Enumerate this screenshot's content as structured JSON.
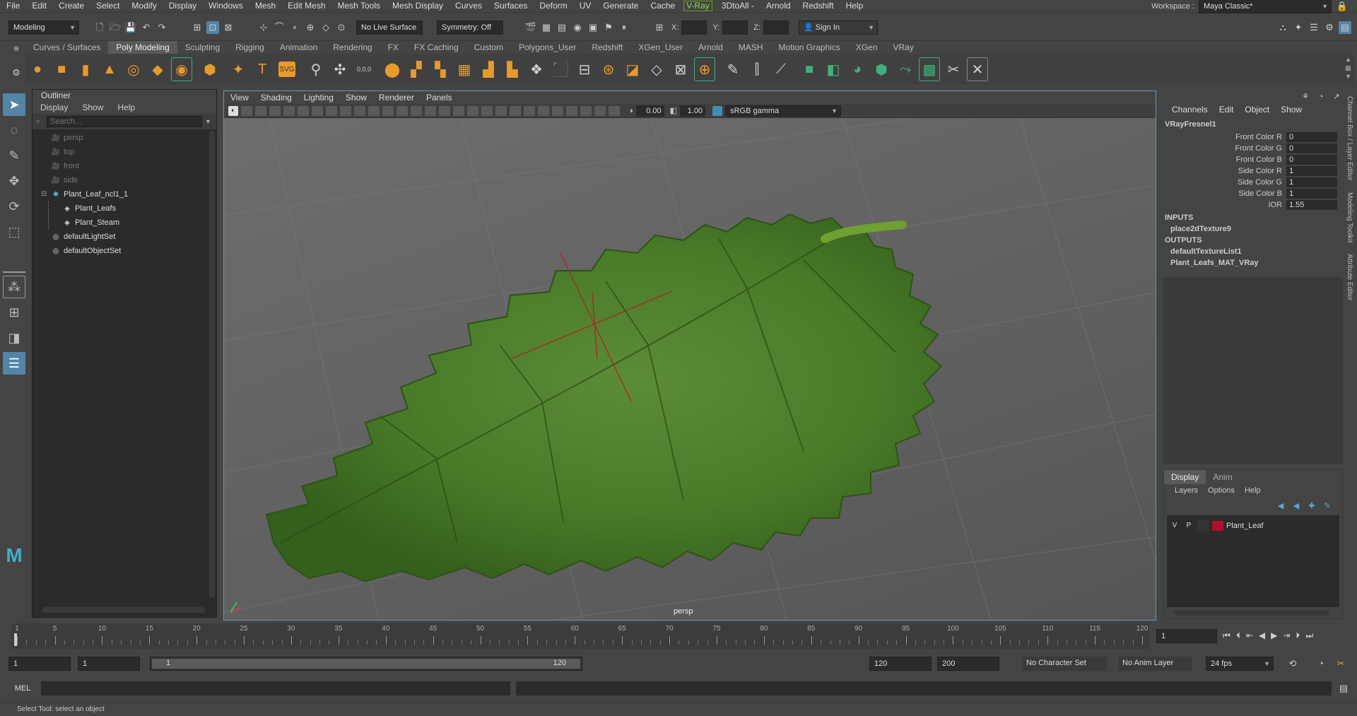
{
  "menubar": {
    "items": [
      "File",
      "Edit",
      "Create",
      "Select",
      "Modify",
      "Display",
      "Windows",
      "Mesh",
      "Edit Mesh",
      "Mesh Tools",
      "Mesh Display",
      "Curves",
      "Surfaces",
      "Deform",
      "UV",
      "Generate",
      "Cache",
      "V-Ray",
      "3DtoAll -",
      "Arnold",
      "Redshift",
      "Help"
    ],
    "workspace_label": "Workspace :",
    "workspace_value": "Maya Classic*"
  },
  "statusline": {
    "mode": "Modeling",
    "live_surface": "No Live Surface",
    "symmetry": "Symmetry: Off",
    "x_label": "X:",
    "y_label": "Y:",
    "z_label": "Z:",
    "sign_in": "Sign In"
  },
  "shelf": {
    "tabs": [
      "Curves / Surfaces",
      "Poly Modeling",
      "Sculpting",
      "Rigging",
      "Animation",
      "Rendering",
      "FX",
      "FX Caching",
      "Custom",
      "Polygons_User",
      "Redshift",
      "XGen_User",
      "Arnold",
      "MASH",
      "Motion Graphics",
      "XGen",
      "VRay"
    ],
    "active_tab": "Poly Modeling",
    "text_icon": "T",
    "svg_icon": "SVG",
    "coords_icon": "0,0,0"
  },
  "outliner": {
    "title": "Outliner",
    "menu": [
      "Display",
      "Show",
      "Help"
    ],
    "search_placeholder": "Search...",
    "items": [
      {
        "label": "persp",
        "icon": "camera-icon",
        "indent": 0,
        "dim": true
      },
      {
        "label": "top",
        "icon": "camera-icon",
        "indent": 0,
        "dim": true
      },
      {
        "label": "front",
        "icon": "camera-icon",
        "indent": 0,
        "dim": true
      },
      {
        "label": "side",
        "icon": "camera-icon",
        "indent": 0,
        "dim": true
      },
      {
        "label": "Plant_Leaf_ncl1_1",
        "icon": "group-icon",
        "indent": 0,
        "dim": false
      },
      {
        "label": "Plant_Leafs",
        "icon": "mesh-icon",
        "indent": 1,
        "dim": false
      },
      {
        "label": "Plant_Steam",
        "icon": "mesh-icon",
        "indent": 1,
        "dim": false
      },
      {
        "label": "defaultLightSet",
        "icon": "set-icon",
        "indent": 0,
        "dim": false
      },
      {
        "label": "defaultObjectSet",
        "icon": "set-icon",
        "indent": 0,
        "dim": false
      }
    ]
  },
  "viewport": {
    "menu": [
      "View",
      "Shading",
      "Lighting",
      "Show",
      "Renderer",
      "Panels"
    ],
    "exposure": "0.00",
    "gamma": "1.00",
    "color_space": "sRGB gamma",
    "camera_label": "persp"
  },
  "channelbox": {
    "menu": [
      "Channels",
      "Edit",
      "Object",
      "Show"
    ],
    "node": "VRayFresnel1",
    "attrs": [
      {
        "name": "Front Color R",
        "value": "0"
      },
      {
        "name": "Front Color G",
        "value": "0"
      },
      {
        "name": "Front Color B",
        "value": "0"
      },
      {
        "name": "Side Color R",
        "value": "1"
      },
      {
        "name": "Side Color G",
        "value": "1"
      },
      {
        "name": "Side Color B",
        "value": "1"
      },
      {
        "name": "IOR",
        "value": "1.55"
      }
    ],
    "inputs_label": "INPUTS",
    "inputs": [
      "place2dTexture9"
    ],
    "outputs_label": "OUTPUTS",
    "outputs": [
      "defaultTextureList1",
      "Plant_Leafs_MAT_VRay"
    ],
    "side_tabs": [
      "Channel Box / Layer Editor",
      "Modeling Toolkit",
      "Attribute Editor"
    ]
  },
  "layers": {
    "tabs": [
      "Display",
      "Anim"
    ],
    "menu": [
      "Layers",
      "Options",
      "Help"
    ],
    "rows": [
      {
        "v": "V",
        "p": "P",
        "name": "Plant_Leaf",
        "color": "#b0102a"
      }
    ]
  },
  "timeline": {
    "start": 1,
    "end": 120,
    "labels": [
      "1",
      "5",
      "10",
      "15",
      "20",
      "25",
      "30",
      "35",
      "40",
      "45",
      "50",
      "55",
      "60",
      "65",
      "70",
      "75",
      "80",
      "85",
      "90",
      "95",
      "100",
      "105",
      "110",
      "115",
      "120"
    ],
    "current_frame": "1"
  },
  "range": {
    "start_field": "1",
    "anim_start": "1",
    "range_start": "1",
    "range_end": "120",
    "anim_end_field": "120",
    "max_field": "200",
    "character_set": "No Character Set",
    "anim_layer": "No Anim Layer",
    "fps": "24 fps"
  },
  "cmdline": {
    "label": "MEL"
  },
  "helpline": {
    "text": "Select Tool: select an object"
  },
  "colors": {
    "accent": "#5285a6",
    "vray": "#8fdc3c",
    "leaf": "#4a7a2c",
    "layer_color": "#b0102a"
  }
}
